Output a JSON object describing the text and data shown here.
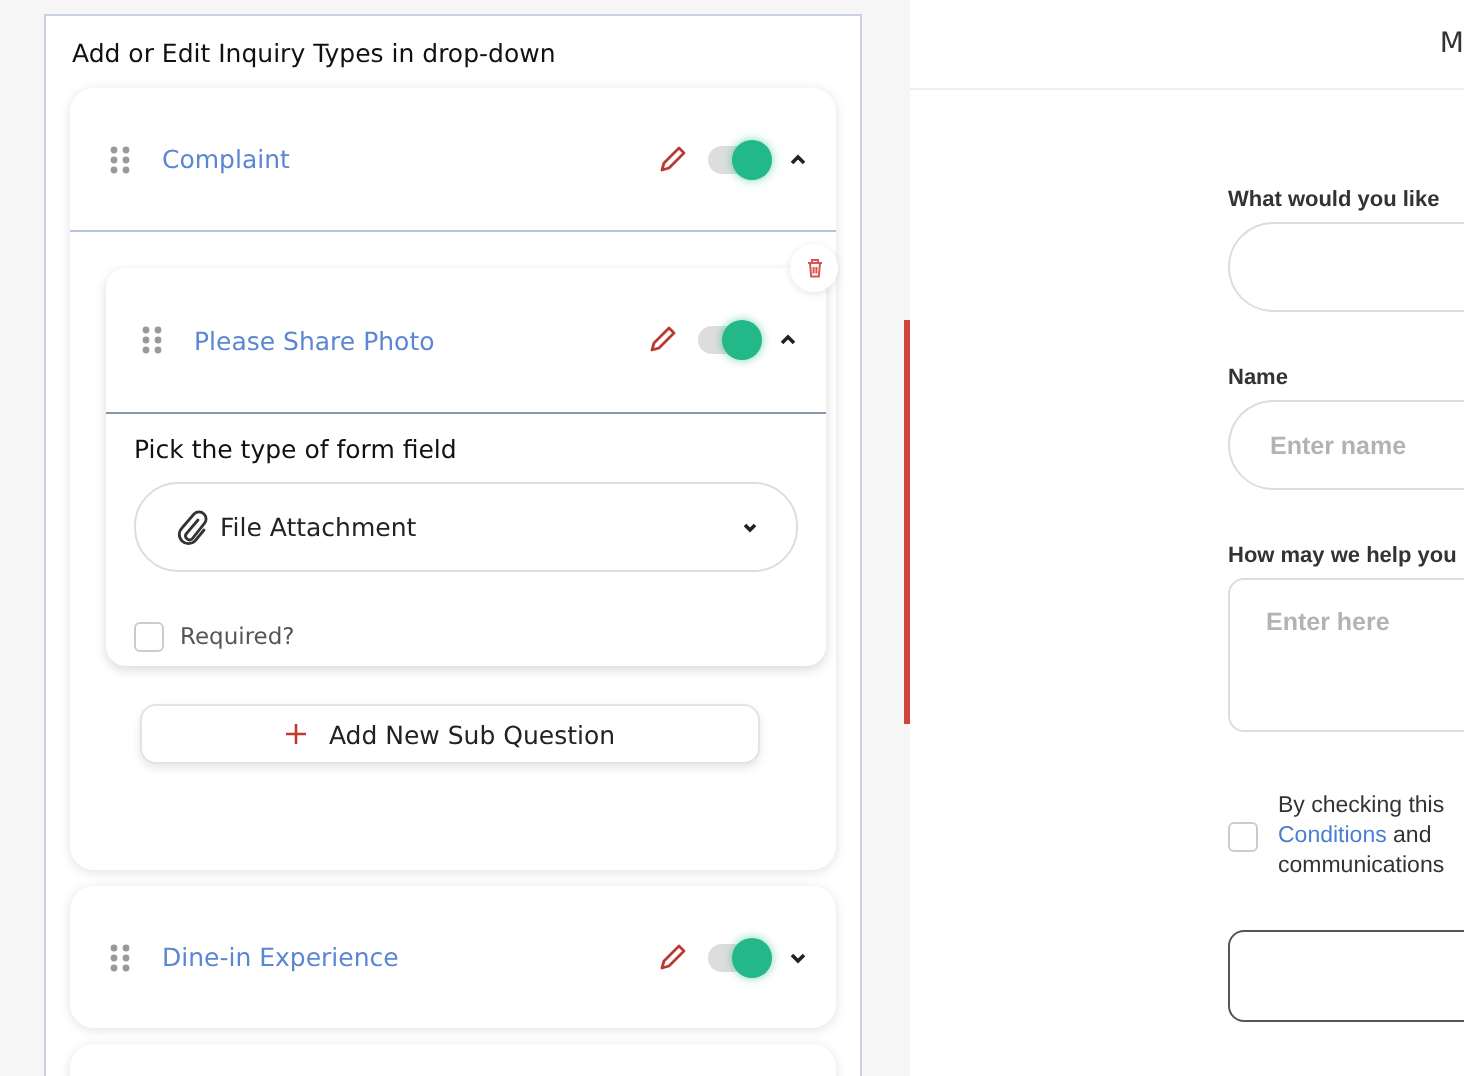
{
  "panel": {
    "heading": "Add or Edit Inquiry Types in drop-down"
  },
  "inquiry_types": [
    {
      "label": "Complaint",
      "on": true,
      "expanded": true,
      "sub_questions": [
        {
          "label": "Please Share Photo",
          "on": true,
          "expanded": true,
          "field_type_label": "Pick the type of form field",
          "field_type": "File Attachment",
          "required_label": "Required?",
          "required": false
        }
      ],
      "add_button": "Add New Sub Question"
    },
    {
      "label": "Dine-in Experience",
      "on": true,
      "expanded": false
    }
  ],
  "preview": {
    "header": "M",
    "fields": [
      {
        "kind": "select",
        "label": "What would you like"
      },
      {
        "kind": "text",
        "label": "Name",
        "placeholder": "Enter name"
      },
      {
        "kind": "textarea",
        "label": "How may we help you",
        "placeholder": "Enter here"
      }
    ],
    "consent": {
      "checked": false,
      "text_before": "By checking this",
      "link": "Conditions",
      "text_after": "and",
      "text_end": "communications"
    }
  }
}
